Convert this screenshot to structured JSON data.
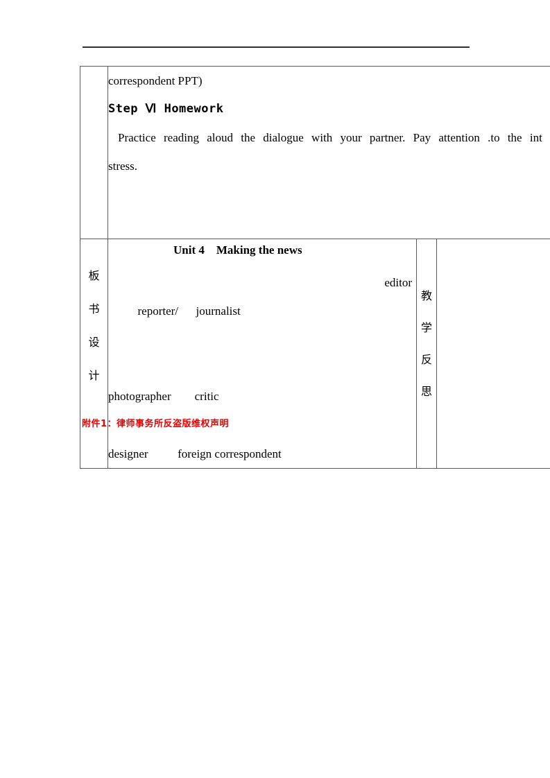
{
  "document": {
    "homework_section": {
      "continued_text": "correspondent PPT)",
      "heading": "Step Ⅵ Homework",
      "instruction_line_1": "Practice reading aloud the dialogue with your partner. Pay attention .to the int",
      "instruction_line_2": "stress."
    },
    "blackboard_section": {
      "row_label": "板书设计",
      "row_label_chars": [
        "板",
        "书",
        "设",
        "计"
      ],
      "title": "Unit 4    Making the news",
      "line_1_left": "reporter/      journalist",
      "line_1_right": "editor",
      "line_2": "photographer        critic",
      "line_3": "designer          foreign correspondent"
    },
    "reflection_section": {
      "row_label": "教学反思",
      "row_label_chars": [
        "教",
        "学",
        "反",
        "思"
      ],
      "content": ""
    },
    "footer": {
      "copyright_notice": "附件1：律师事务所反盗版维权声明",
      "color": "#EE0000"
    }
  }
}
